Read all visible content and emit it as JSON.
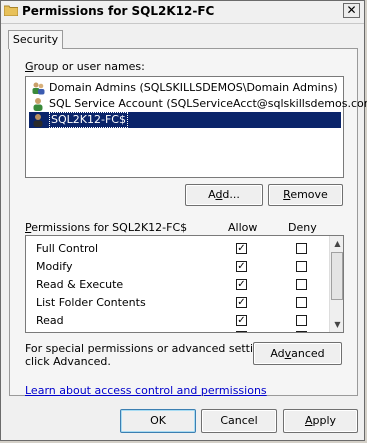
{
  "window": {
    "title": "Permissions for SQL2K12-FC",
    "close_glyph": "✕"
  },
  "tabs": [
    {
      "label": "Security"
    }
  ],
  "groups": {
    "label_prefix": "",
    "label_underlined": "G",
    "label_rest": "roup or user names:",
    "items": [
      {
        "name": "Domain Admins (SQLSKILLSDEMOS\\Domain Admins)",
        "icon": "group-icon",
        "selected": false
      },
      {
        "name": "SQL Service Account (SQLServiceAcct@sqlskillsdemos.com)",
        "icon": "user-icon",
        "selected": false
      },
      {
        "name": "SQL2K12-FC$",
        "icon": "computer-account-icon",
        "selected": true
      }
    ]
  },
  "buttons": {
    "add_prefix": "A",
    "add_underlined": "d",
    "add_rest": "d...",
    "remove_underlined": "R",
    "remove_rest": "emove",
    "advanced_prefix": "Ad",
    "advanced_underlined": "v",
    "advanced_rest": "anced",
    "ok": "OK",
    "cancel": "Cancel",
    "apply_underlined": "A",
    "apply_rest": "pply"
  },
  "permissions": {
    "label_underlined": "P",
    "label_rest": "ermissions for SQL2K12-FC$",
    "allow_header": "Allow",
    "deny_header": "Deny",
    "rows": [
      {
        "name": "Full Control",
        "allow": true,
        "deny": false
      },
      {
        "name": "Modify",
        "allow": true,
        "deny": false
      },
      {
        "name": "Read & Execute",
        "allow": true,
        "deny": false
      },
      {
        "name": "List Folder Contents",
        "allow": true,
        "deny": false
      },
      {
        "name": "Read",
        "allow": true,
        "deny": false
      },
      {
        "name": "",
        "allow": true,
        "deny": false
      }
    ]
  },
  "special_note": {
    "line1": "For special permissions or advanced settings,",
    "line2": "click Advanced."
  },
  "help_link": "Learn about access control and permissions",
  "check_glyph": "✓"
}
